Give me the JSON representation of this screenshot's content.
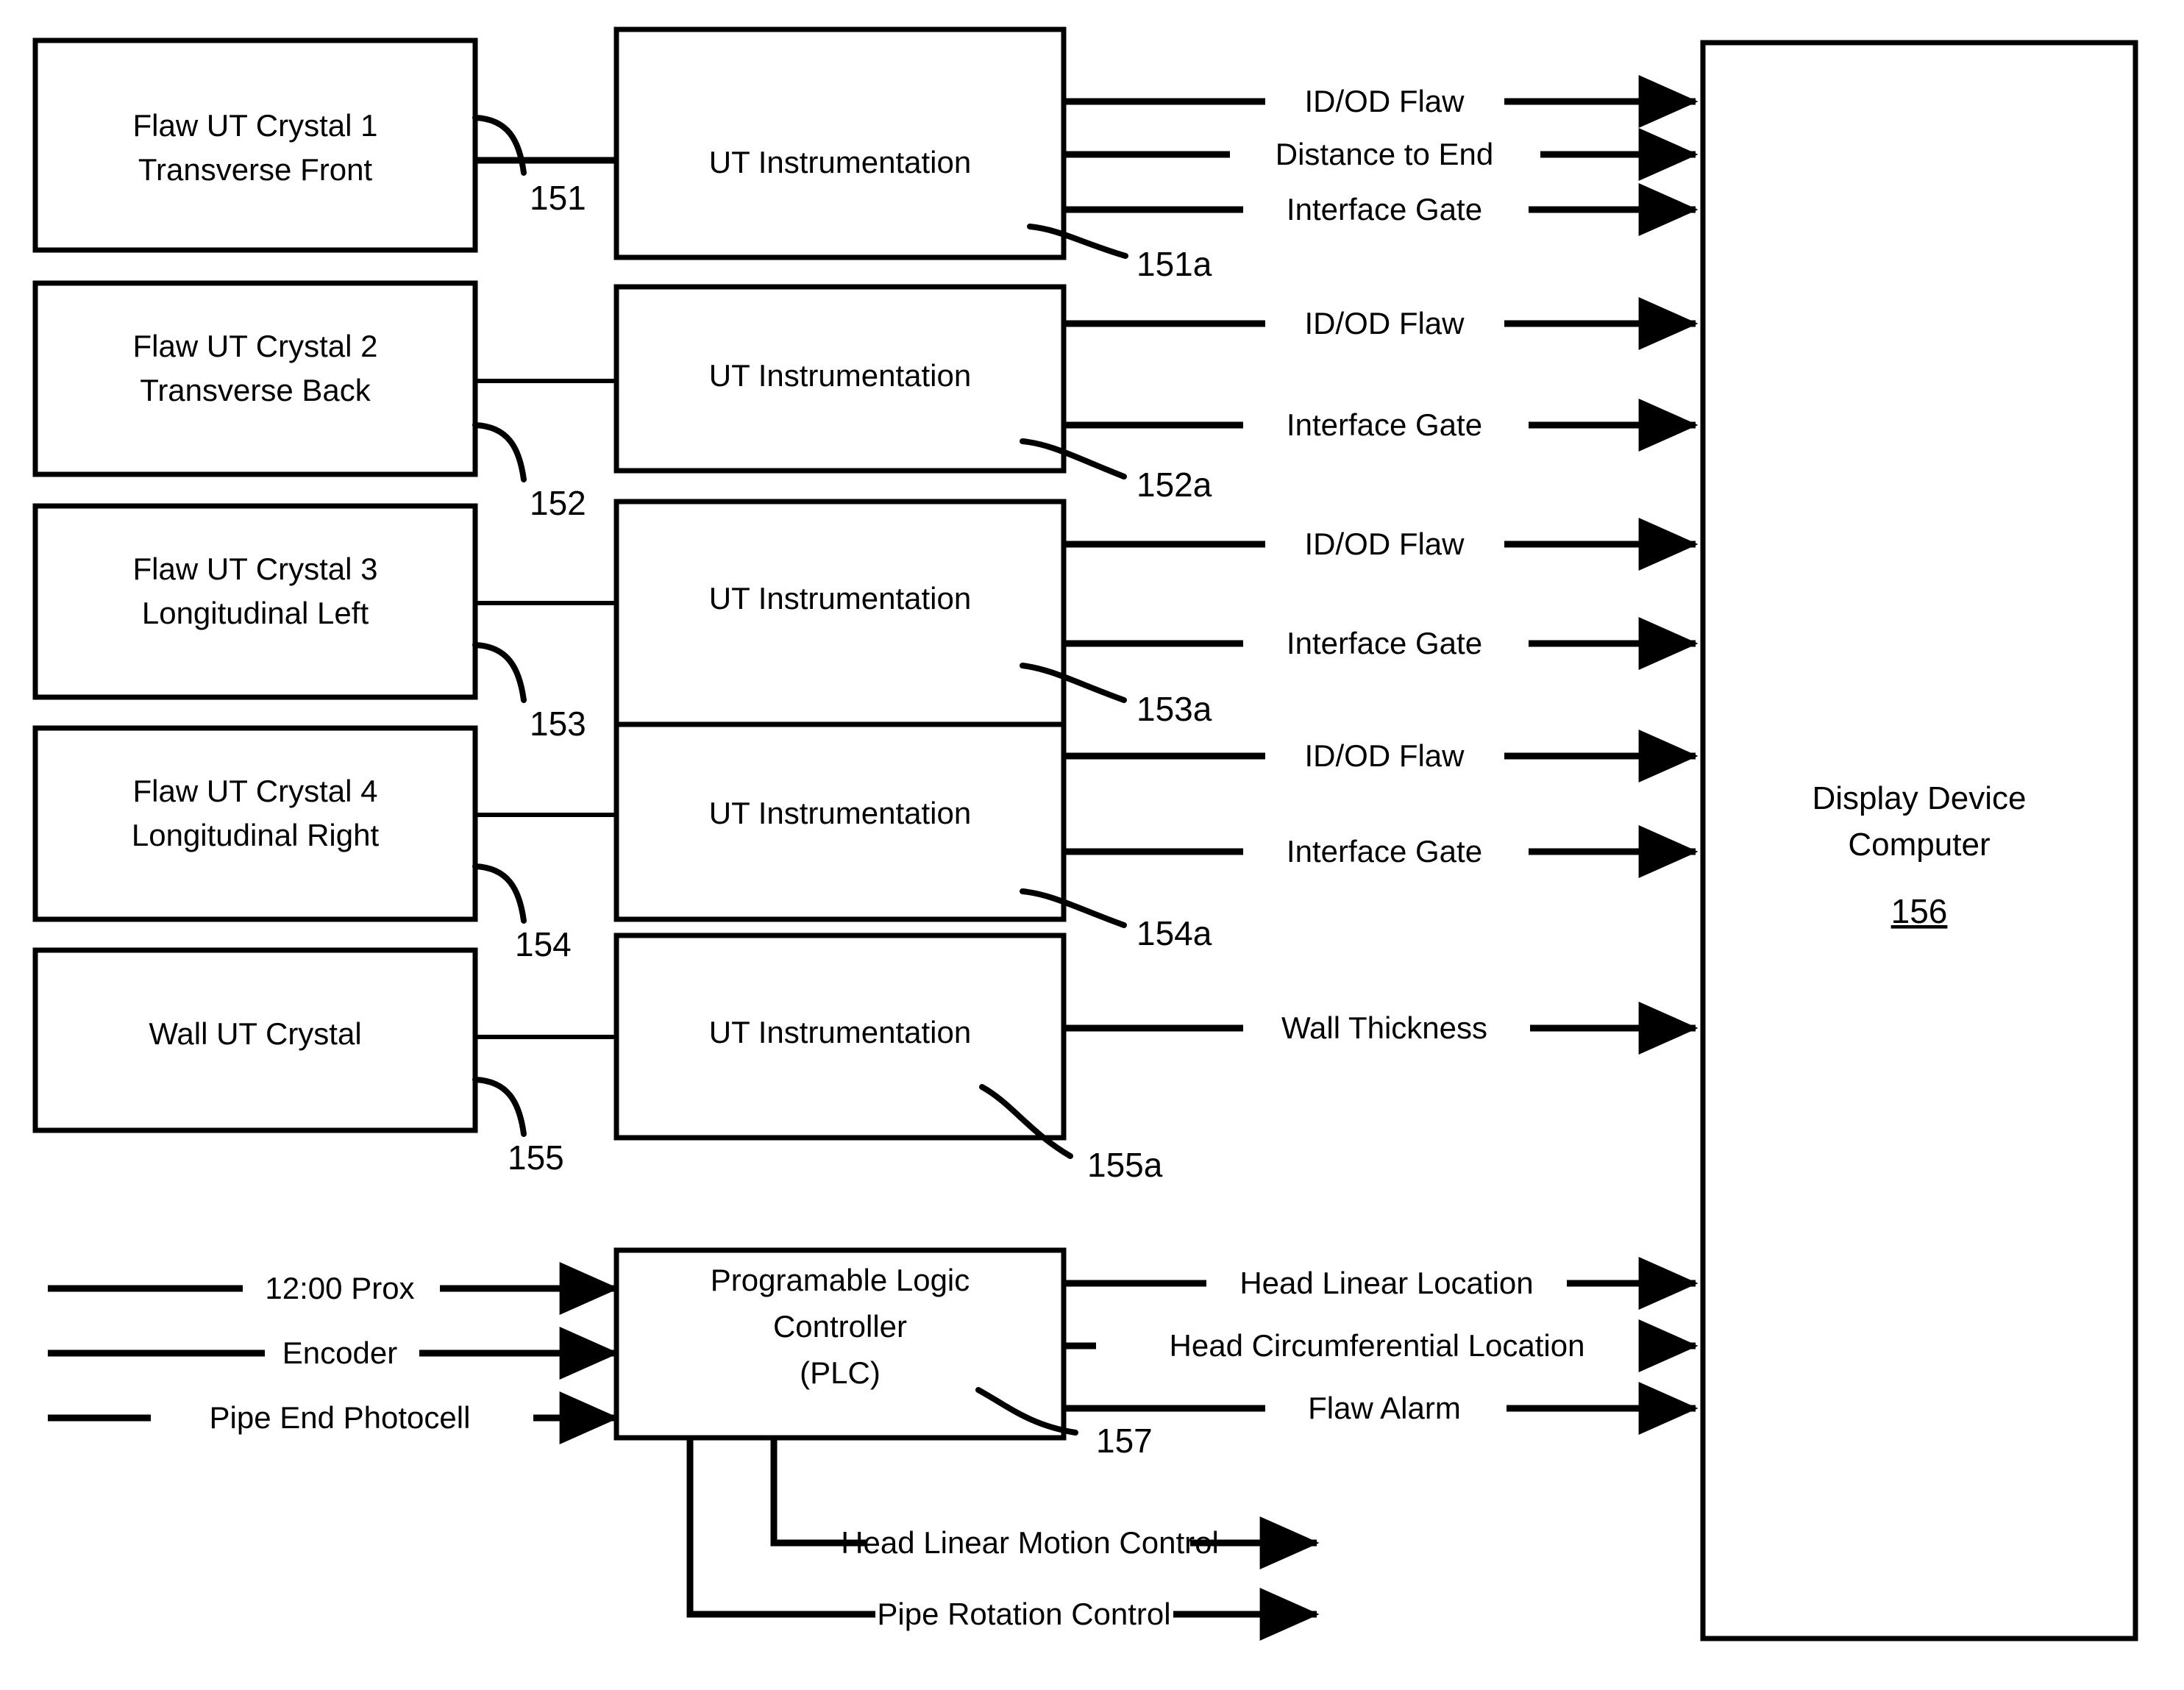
{
  "diagram": {
    "sensor_boxes": [
      {
        "line1": "Flaw UT Crystal 1",
        "line2": "Transverse Front",
        "ref": "151"
      },
      {
        "line1": "Flaw UT Crystal 2",
        "line2": "Transverse Back",
        "ref": "152"
      },
      {
        "line1": "Flaw UT Crystal 3",
        "line2": "Longitudinal Left",
        "ref": "153"
      },
      {
        "line1": "Flaw UT Crystal 4",
        "line2": "Longitudinal Right",
        "ref": "154"
      },
      {
        "line1": "Wall UT Crystal",
        "line2": "",
        "ref": "155"
      }
    ],
    "instrument_boxes": [
      {
        "label": "UT Instrumentation",
        "ref": "151a",
        "outputs": [
          "ID/OD Flaw",
          "Distance to End",
          "Interface Gate"
        ]
      },
      {
        "label": "UT Instrumentation",
        "ref": "152a",
        "outputs": [
          "ID/OD Flaw",
          "Interface Gate"
        ]
      },
      {
        "label": "UT Instrumentation",
        "ref": "153a",
        "outputs": [
          "ID/OD Flaw",
          "Interface Gate"
        ]
      },
      {
        "label": "UT Instrumentation",
        "ref": "154a",
        "outputs": [
          "ID/OD Flaw",
          "Interface Gate"
        ]
      },
      {
        "label": "UT Instrumentation",
        "ref": "155a",
        "outputs": [
          "Wall Thickness"
        ]
      }
    ],
    "display_device": {
      "line1": "Display Device",
      "line2": "Computer",
      "ref": "156"
    },
    "plc": {
      "line1": "Programable Logic",
      "line2": "Controller",
      "line3": "(PLC)",
      "ref": "157",
      "inputs": [
        "12:00 Prox",
        "Encoder",
        "Pipe End Photocell"
      ],
      "outputs_to_display": [
        "Head Linear Location",
        "Head Circumferential Location",
        "Flaw Alarm"
      ],
      "control_outputs": [
        "Head Linear Motion Control",
        "Pipe Rotation Control"
      ]
    },
    "colors": {
      "line": "#000000",
      "background": "#ffffff"
    }
  }
}
